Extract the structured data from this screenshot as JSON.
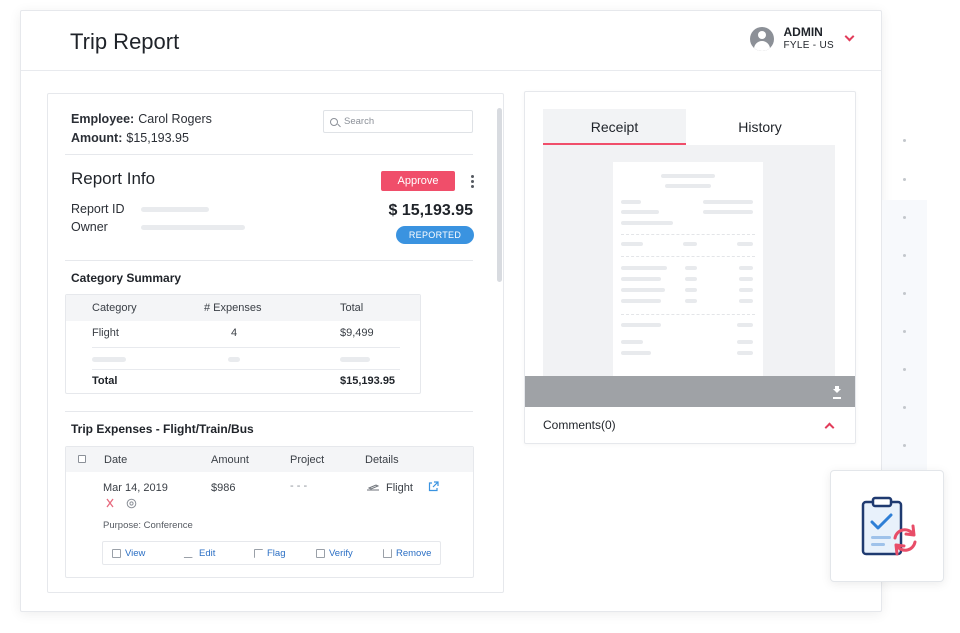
{
  "header": {
    "title": "Trip Report",
    "user_name": "ADMIN",
    "user_org": "FYLE - US"
  },
  "employee": {
    "employee_label": "Employee:",
    "employee_name": "Carol Rogers",
    "amount_label": "Amount:",
    "amount_value": "$15,193.95"
  },
  "search": {
    "placeholder": "Search"
  },
  "report_info": {
    "title": "Report Info",
    "approve_label": "Approve",
    "report_id_label": "Report ID",
    "owner_label": "Owner",
    "total": "$ 15,193.95",
    "status": "REPORTED"
  },
  "category_summary": {
    "title": "Category Summary",
    "columns": [
      "Category",
      "# Expenses",
      "Total"
    ],
    "rows": [
      {
        "category": "Flight",
        "count": "4",
        "total": "$9,499"
      }
    ],
    "total_label": "Total",
    "total_value": "$15,193.95"
  },
  "trip_expenses": {
    "title": "Trip Expenses - Flight/Train/Bus",
    "columns": [
      "Date",
      "Amount",
      "Project",
      "Details"
    ],
    "row": {
      "date": "Mar 14, 2019",
      "amount": "$986",
      "project": "- - -",
      "details": "Flight",
      "purpose": "Purpose: Conference"
    },
    "actions": [
      "View",
      "Edit",
      "Flag",
      "Verify",
      "Remove"
    ]
  },
  "receipt_panel": {
    "tabs": [
      "Receipt",
      "History"
    ],
    "active_tab": "Receipt",
    "comments": "Comments(0)"
  },
  "colors": {
    "accent": "#f04e6a",
    "status_blue": "#3a93e0",
    "link_blue": "#2b6fc4"
  },
  "icons": [
    "avatar-icon",
    "chevron-down-icon",
    "search-icon",
    "kebab-menu-icon",
    "plane-icon",
    "external-link-icon",
    "download-icon",
    "chevron-up-icon",
    "clipboard-refresh-icon"
  ]
}
